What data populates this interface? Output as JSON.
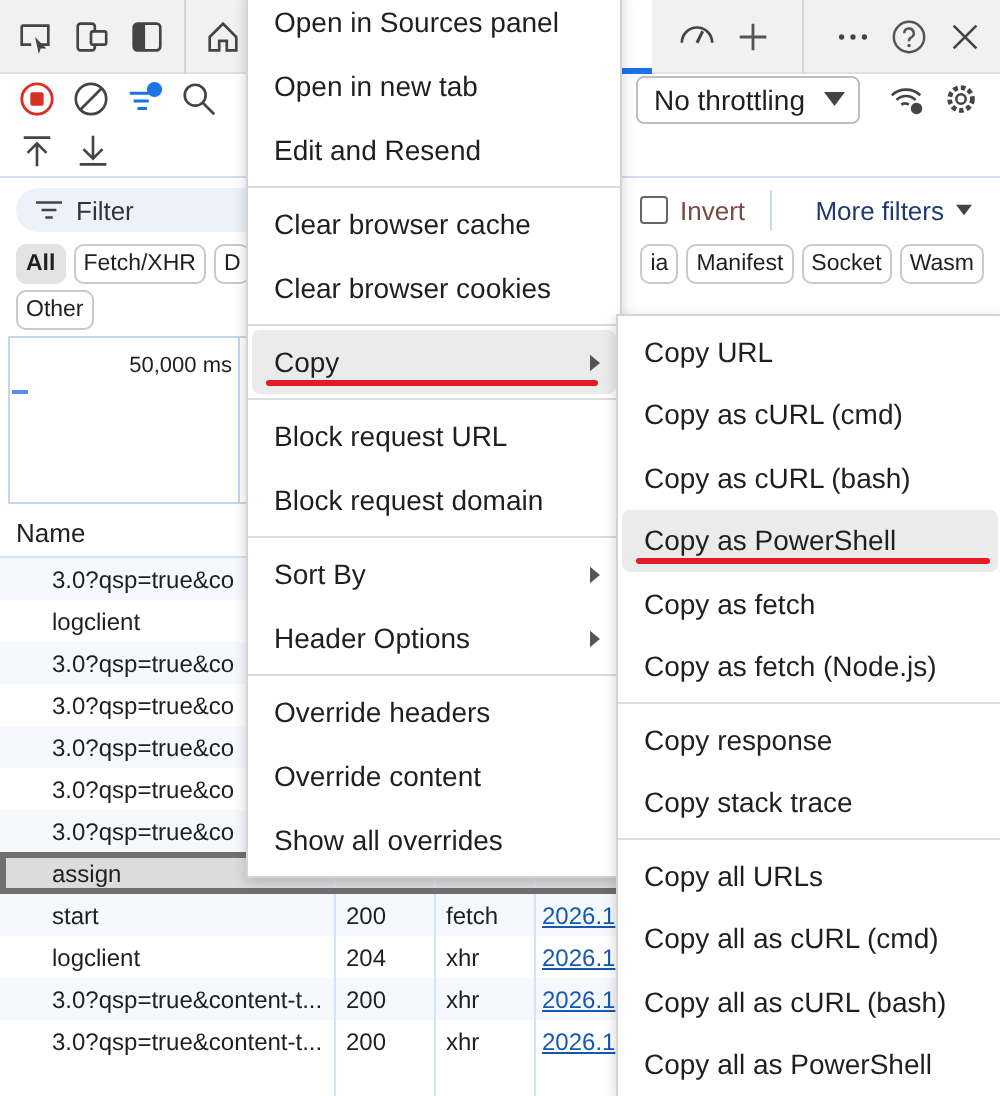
{
  "toolbar": {
    "throttling": "No throttling"
  },
  "filter": {
    "placeholder": "Filter",
    "invert": {
      "label": "Invert",
      "checked": false
    },
    "more_filters": "More filters"
  },
  "type_chips_left": [
    {
      "label": "All",
      "selected": true
    },
    {
      "label": "Fetch/XHR",
      "selected": false
    },
    {
      "label": "D",
      "selected": false
    }
  ],
  "type_chips_right": [
    {
      "label": "ia",
      "selected": false
    },
    {
      "label": "Manifest",
      "selected": false
    },
    {
      "label": "Socket",
      "selected": false
    },
    {
      "label": "Wasm",
      "selected": false
    }
  ],
  "type_chips_row2": [
    {
      "label": "Other",
      "selected": false
    }
  ],
  "overview": {
    "time_label": "50,000 ms"
  },
  "table": {
    "columns": [
      "Name"
    ],
    "rows": [
      {
        "name": "3.0?qsp=true&co",
        "selected": false,
        "annotated": false
      },
      {
        "name": "logclient",
        "selected": false,
        "annotated": false
      },
      {
        "name": "3.0?qsp=true&co",
        "selected": false,
        "annotated": false
      },
      {
        "name": "3.0?qsp=true&co",
        "selected": false,
        "annotated": false
      },
      {
        "name": "3.0?qsp=true&co",
        "selected": false,
        "annotated": false
      },
      {
        "name": "3.0?qsp=true&co",
        "selected": false,
        "annotated": false
      },
      {
        "name": "3.0?qsp=true&co",
        "selected": false,
        "annotated": false
      },
      {
        "name": "assign",
        "selected": true,
        "annotated": true
      },
      {
        "name": "start",
        "status": "200",
        "type": "fetch",
        "initiator": "2026.1",
        "selected": false,
        "annotated": false
      },
      {
        "name": "logclient",
        "status": "204",
        "type": "xhr",
        "initiator": "2026.1",
        "selected": false,
        "annotated": false
      },
      {
        "name": "3.0?qsp=true&content-t...",
        "status": "200",
        "type": "xhr",
        "initiator": "2026.1",
        "selected": false,
        "annotated": false
      },
      {
        "name": "3.0?qsp=true&content-t...",
        "status": "200",
        "type": "xhr",
        "initiator": "2026.1",
        "selected": false,
        "annotated": false
      }
    ]
  },
  "context_menu": {
    "sections": [
      {
        "items": [
          {
            "label": "Open in Sources panel",
            "kind": "action",
            "selected": false,
            "annotated": false
          },
          {
            "label": "Open in new tab",
            "kind": "action",
            "selected": false,
            "annotated": false
          },
          {
            "label": "Edit and Resend",
            "kind": "action",
            "selected": false,
            "annotated": false
          }
        ]
      },
      {
        "items": [
          {
            "label": "Clear browser cache",
            "kind": "action",
            "selected": false,
            "annotated": false
          },
          {
            "label": "Clear browser cookies",
            "kind": "action",
            "selected": false,
            "annotated": false
          }
        ]
      },
      {
        "items": [
          {
            "label": "Copy",
            "kind": "submenu",
            "selected": true,
            "annotated": true
          }
        ]
      },
      {
        "items": [
          {
            "label": "Block request URL",
            "kind": "action",
            "selected": false,
            "annotated": false
          },
          {
            "label": "Block request domain",
            "kind": "action",
            "selected": false,
            "annotated": false
          }
        ]
      },
      {
        "items": [
          {
            "label": "Sort By",
            "kind": "submenu",
            "selected": false,
            "annotated": false
          },
          {
            "label": "Header Options",
            "kind": "submenu",
            "selected": false,
            "annotated": false
          }
        ]
      },
      {
        "items": [
          {
            "label": "Override headers",
            "kind": "action",
            "selected": false,
            "annotated": false
          },
          {
            "label": "Override content",
            "kind": "action",
            "selected": false,
            "annotated": false
          },
          {
            "label": "Show all overrides",
            "kind": "action",
            "selected": false,
            "annotated": false
          }
        ]
      }
    ]
  },
  "copy_submenu": {
    "sections": [
      {
        "items": [
          {
            "label": "Copy URL",
            "kind": "action",
            "selected": false,
            "annotated": false
          },
          {
            "label": "Copy as cURL (cmd)",
            "kind": "action",
            "selected": false,
            "annotated": false
          },
          {
            "label": "Copy as cURL (bash)",
            "kind": "action",
            "selected": false,
            "annotated": false
          },
          {
            "label": "Copy as PowerShell",
            "kind": "action",
            "selected": true,
            "annotated": true
          },
          {
            "label": "Copy as fetch",
            "kind": "action",
            "selected": false,
            "annotated": false
          },
          {
            "label": "Copy as fetch (Node.js)",
            "kind": "action",
            "selected": false,
            "annotated": false
          }
        ]
      },
      {
        "items": [
          {
            "label": "Copy response",
            "kind": "action",
            "selected": false,
            "annotated": false
          },
          {
            "label": "Copy stack trace",
            "kind": "action",
            "selected": false,
            "annotated": false
          }
        ]
      },
      {
        "items": [
          {
            "label": "Copy all URLs",
            "kind": "action",
            "selected": false,
            "annotated": false
          },
          {
            "label": "Copy all as cURL (cmd)",
            "kind": "action",
            "selected": false,
            "annotated": false
          },
          {
            "label": "Copy all as cURL (bash)",
            "kind": "action",
            "selected": false,
            "annotated": false
          },
          {
            "label": "Copy all as PowerShell",
            "kind": "action",
            "selected": false,
            "annotated": false
          }
        ]
      }
    ]
  }
}
